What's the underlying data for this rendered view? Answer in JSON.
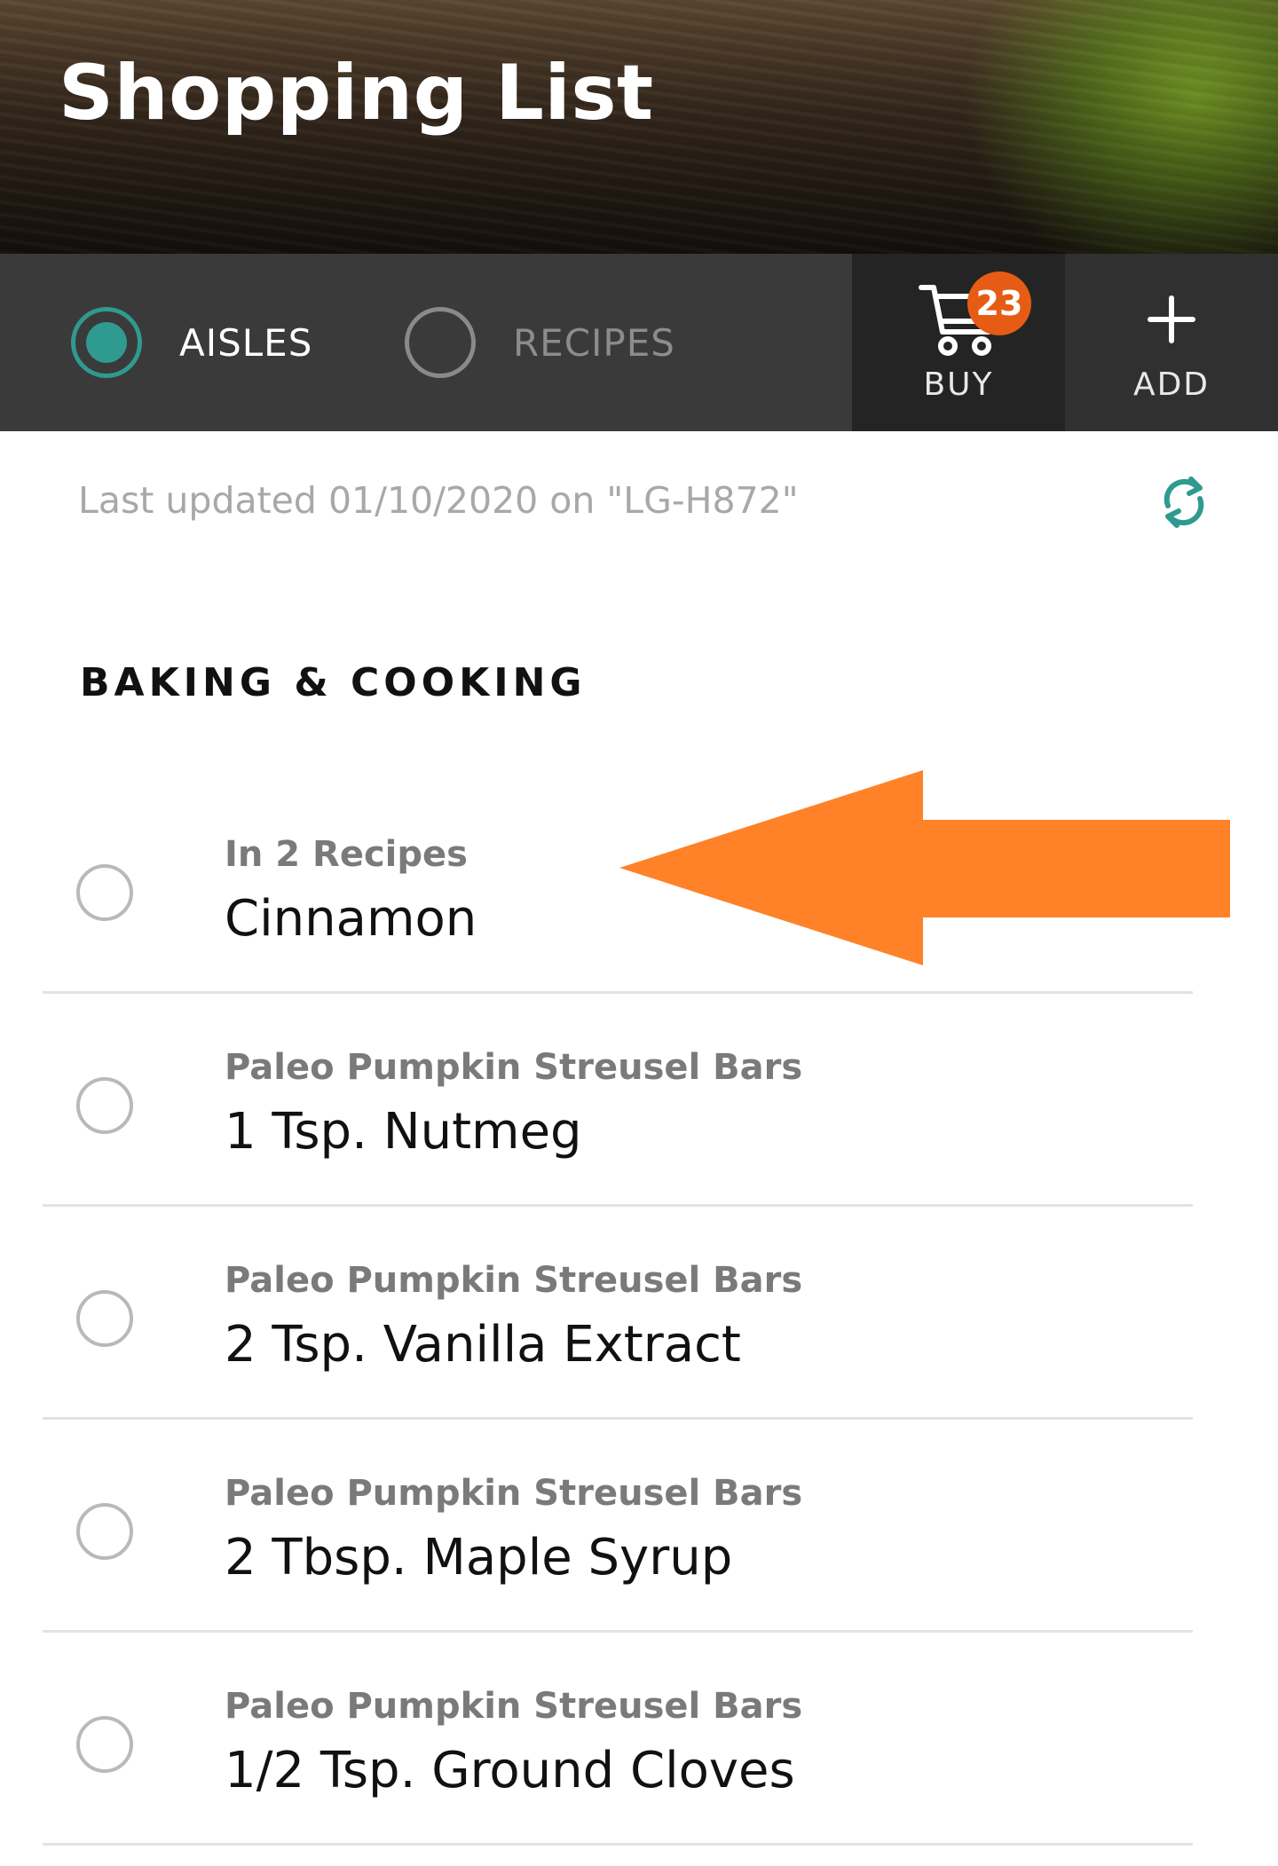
{
  "header": {
    "title": "Shopping List"
  },
  "toolbar": {
    "view_options": [
      {
        "label": "AISLES",
        "selected": true
      },
      {
        "label": "RECIPES",
        "selected": false
      }
    ],
    "buy": {
      "label": "BUY",
      "badge_count": "23",
      "icon": "shopping-cart-icon"
    },
    "add": {
      "label": "ADD",
      "icon": "plus-icon"
    }
  },
  "sync": {
    "last_updated": "Last updated 01/10/2020 on \"LG-H872\"",
    "icon": "sync-icon"
  },
  "section": {
    "title": "BAKING & COOKING"
  },
  "items": [
    {
      "subtitle": "In 2 Recipes",
      "name": "Cinnamon",
      "checked": false
    },
    {
      "subtitle": "Paleo Pumpkin Streusel Bars",
      "name": "1 Tsp. Nutmeg",
      "checked": false
    },
    {
      "subtitle": "Paleo Pumpkin Streusel Bars",
      "name": "2 Tsp. Vanilla Extract",
      "checked": false
    },
    {
      "subtitle": "Paleo Pumpkin Streusel Bars",
      "name": "2 Tbsp. Maple Syrup",
      "checked": false
    },
    {
      "subtitle": "Paleo Pumpkin Streusel Bars",
      "name": "1/2 Tsp. Ground Cloves",
      "checked": false
    }
  ],
  "colors": {
    "accent_teal": "#2f9a8f",
    "badge_orange": "#e65c14",
    "annotation_orange": "#ff8229",
    "toolbar_bg": "#3a3a3a"
  }
}
